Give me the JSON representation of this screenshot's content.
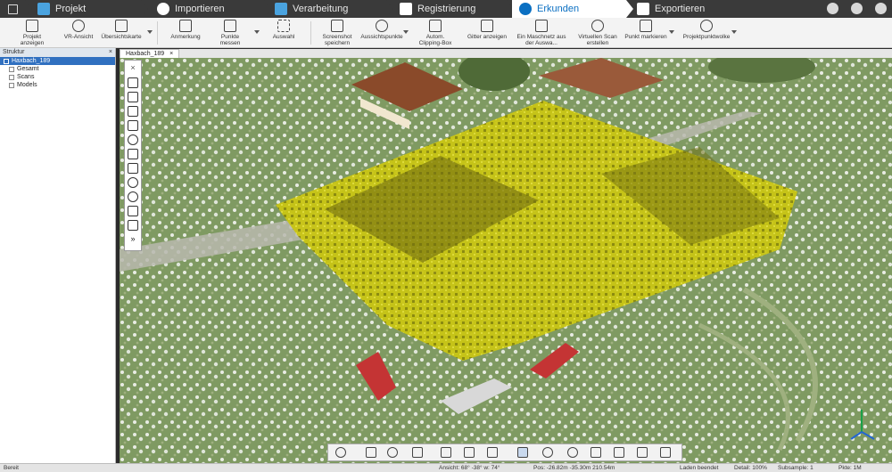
{
  "workflow_tabs": [
    {
      "label": "Projekt",
      "icon": "folder-icon",
      "color": "#4aa3df"
    },
    {
      "label": "Importieren",
      "icon": "import-icon",
      "color": "#ffffff"
    },
    {
      "label": "Verarbeitung",
      "icon": "filter-icon",
      "color": "#4aa3df"
    },
    {
      "label": "Registrierung",
      "icon": "registration-icon",
      "color": "#ffffff"
    },
    {
      "label": "Erkunden",
      "icon": "explore-icon",
      "color": "#0a6fc2",
      "active": true
    },
    {
      "label": "Exportieren",
      "icon": "export-icon",
      "color": "#ffffff"
    }
  ],
  "ribbon": {
    "projekt_anzeigen": "Projekt anzeigen",
    "vr_ansicht": "VR-Ansicht",
    "uebersichtskarte": "Übersichtskarte",
    "anmerkung": "Anmerkung",
    "punkte_messen": "Punkte messen",
    "auswahl": "Auswahl",
    "screenshot": "Screenshot speichern",
    "aussichtspunkte": "Aussichtspunkte",
    "clipping_box": "Autom. Clipping-Box",
    "gitter": "Gitter anzeigen",
    "meshnetz": "Ein Maschnetz aus der Auswa...",
    "virtuellen_scan": "Virtuellen Scan erstellen",
    "punkt_markieren": "Punkt markieren",
    "projektpunktwolke": "Projektpunktwolke"
  },
  "structure": {
    "title": "Struktur",
    "items": [
      {
        "label": "Haxbach_189",
        "selected": true
      },
      {
        "label": "Gesamt"
      },
      {
        "label": "Scans"
      },
      {
        "label": "Models"
      }
    ]
  },
  "view_tab": "Haxbach_189",
  "status": {
    "ready": "Bereit",
    "ansicht": "Ansicht: 68° -38° w: 74°",
    "pos": "Pos: -26.82m -35.30m 210.54m",
    "loading": "Laden beendet",
    "detail": "Detail: 100%",
    "subsample": "Subsample: 1",
    "pkte": "Pkte: 1M"
  },
  "colors": {
    "highlight_yellow": "#d6d21a",
    "accent_blue": "#0a6fc2"
  }
}
